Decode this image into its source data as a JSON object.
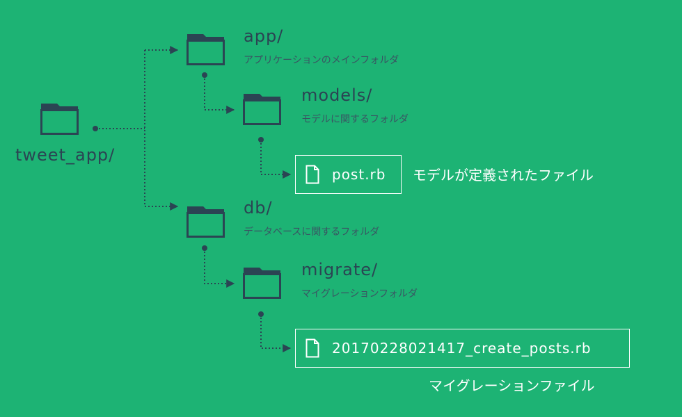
{
  "root": {
    "name": "tweet_app/",
    "icon": "folder-icon"
  },
  "folders": {
    "app": {
      "name": "app/",
      "description": "アプリケーションのメインフォルダ",
      "icon": "folder-icon"
    },
    "models": {
      "name": "models/",
      "description": "モデルに関するフォルダ",
      "icon": "folder-icon"
    },
    "db": {
      "name": "db/",
      "description": "データベースに関するフォルダ",
      "icon": "folder-icon"
    },
    "migrate": {
      "name": "migrate/",
      "description": "マイグレーションフォルダ",
      "icon": "folder-icon"
    }
  },
  "files": {
    "post": {
      "name": "post.rb",
      "description": "モデルが定義されたファイル",
      "icon": "file-icon"
    },
    "migration": {
      "name": "20170228021417_create_posts.rb",
      "description": "マイグレーションファイル",
      "icon": "file-icon"
    }
  },
  "colors": {
    "background": "#1db374",
    "dark": "#2b4453",
    "connector": "#2b4453",
    "file_border": "#ffffff"
  }
}
